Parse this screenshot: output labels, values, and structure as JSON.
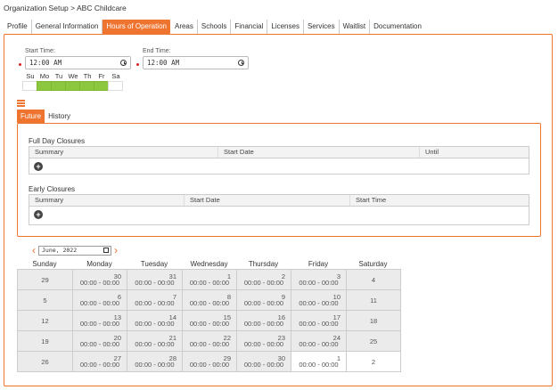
{
  "breadcrumb": "Organization Setup > ABC Childcare",
  "tabs": [
    "Profile",
    "General Information",
    "Hours of Operation",
    "Areas",
    "Schools",
    "Financial",
    "Licenses",
    "Services",
    "Waitlist",
    "Documentation"
  ],
  "active_tab": "Hours of Operation",
  "hours": {
    "start_label": "Start Time:",
    "start_value": "12:00 AM",
    "end_label": "End Time:",
    "end_value": "12:00 AM"
  },
  "days": {
    "labels": [
      "Su",
      "Mo",
      "Tu",
      "We",
      "Th",
      "Fr",
      "Sa"
    ],
    "selected": [
      false,
      true,
      true,
      true,
      true,
      true,
      false
    ]
  },
  "sub_tabs": [
    "Future",
    "History"
  ],
  "full_day": {
    "title": "Full Day Closures",
    "columns": [
      "Summary",
      "Start Date",
      "Until"
    ]
  },
  "early": {
    "title": "Early Closures",
    "columns": [
      "Summary",
      "Start Date",
      "Start Time"
    ]
  },
  "calendar": {
    "month_value": "June, 2022",
    "weekdays": [
      "Sunday",
      "Monday",
      "Tuesday",
      "Wednesday",
      "Thursday",
      "Friday",
      "Saturday"
    ],
    "hours_text": "00:00 - 00:00",
    "weeks": [
      [
        {
          "d": "29",
          "h": false
        },
        {
          "d": "30",
          "h": true
        },
        {
          "d": "31",
          "h": true
        },
        {
          "d": "1",
          "h": true
        },
        {
          "d": "2",
          "h": true
        },
        {
          "d": "3",
          "h": true
        },
        {
          "d": "4",
          "h": false
        }
      ],
      [
        {
          "d": "5",
          "h": false
        },
        {
          "d": "6",
          "h": true
        },
        {
          "d": "7",
          "h": true
        },
        {
          "d": "8",
          "h": true
        },
        {
          "d": "9",
          "h": true
        },
        {
          "d": "10",
          "h": true
        },
        {
          "d": "11",
          "h": false
        }
      ],
      [
        {
          "d": "12",
          "h": false
        },
        {
          "d": "13",
          "h": true
        },
        {
          "d": "14",
          "h": true
        },
        {
          "d": "15",
          "h": true
        },
        {
          "d": "16",
          "h": true
        },
        {
          "d": "17",
          "h": true
        },
        {
          "d": "18",
          "h": false
        }
      ],
      [
        {
          "d": "19",
          "h": false
        },
        {
          "d": "20",
          "h": true
        },
        {
          "d": "21",
          "h": true
        },
        {
          "d": "22",
          "h": true
        },
        {
          "d": "23",
          "h": true
        },
        {
          "d": "24",
          "h": true
        },
        {
          "d": "25",
          "h": false
        }
      ],
      [
        {
          "d": "26",
          "h": false
        },
        {
          "d": "27",
          "h": true
        },
        {
          "d": "28",
          "h": true
        },
        {
          "d": "29",
          "h": true
        },
        {
          "d": "30",
          "h": true
        },
        {
          "d": "1",
          "h": true,
          "white": true
        },
        {
          "d": "2",
          "h": false,
          "white": true
        }
      ]
    ]
  },
  "colors": {
    "accent": "#ee7430",
    "day_on": "#8dc63f",
    "required": "#dd2222"
  }
}
